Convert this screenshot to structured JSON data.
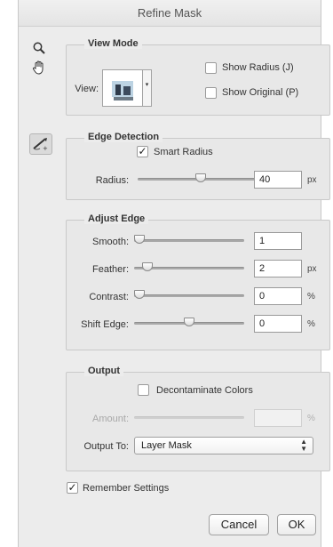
{
  "dialog": {
    "title": "Refine Mask"
  },
  "tools": {
    "zoom_icon": "magnifier-icon",
    "hand_icon": "hand-icon",
    "refine_brush_icon": "refine-radius-brush-icon"
  },
  "view_mode": {
    "title": "View Mode",
    "view_label": "View:",
    "show_radius": {
      "label": "Show Radius (J)",
      "checked": false
    },
    "show_original": {
      "label": "Show Original (P)",
      "checked": false
    }
  },
  "edge_detection": {
    "title": "Edge Detection",
    "smart_radius": {
      "label": "Smart Radius",
      "checked": true
    },
    "radius": {
      "label": "Radius:",
      "value": "40",
      "unit": "px",
      "level": 0.5
    }
  },
  "adjust_edge": {
    "title": "Adjust Edge",
    "smooth": {
      "label": "Smooth:",
      "value": "1",
      "unit": "",
      "level": 0.0
    },
    "feather": {
      "label": "Feather:",
      "value": "2",
      "unit": "px",
      "level": 0.08
    },
    "contrast": {
      "label": "Contrast:",
      "value": "0",
      "unit": "%",
      "level": 0.0
    },
    "shift_edge": {
      "label": "Shift Edge:",
      "value": "0",
      "unit": "%",
      "level": 0.5
    }
  },
  "output": {
    "title": "Output",
    "decontaminate": {
      "label": "Decontaminate Colors",
      "checked": false
    },
    "amount": {
      "label": "Amount:",
      "value": "",
      "unit": "%",
      "disabled": true
    },
    "output_to_label": "Output To:",
    "output_to_value": "Layer Mask"
  },
  "remember": {
    "label": "Remember Settings",
    "checked": true
  },
  "buttons": {
    "cancel": "Cancel",
    "ok": "OK"
  }
}
